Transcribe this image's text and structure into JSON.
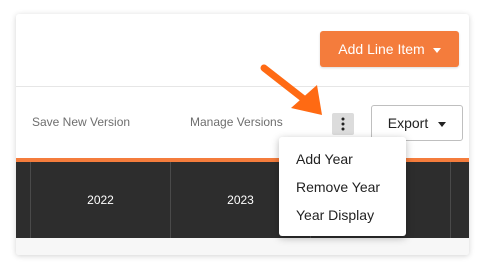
{
  "colors": {
    "accent": "#f47c3c",
    "table_header_bg": "#2d2d2d",
    "kebab_bg": "#dcdcdc"
  },
  "header": {
    "add_line_item_label": "Add Line Item"
  },
  "toolbar": {
    "save_new_version_label": "Save New Version",
    "manage_versions_label": "Manage Versions",
    "more_actions_icon": "vertical-ellipsis-icon",
    "export_label": "Export"
  },
  "table": {
    "columns": [
      "2022",
      "2023",
      "",
      ""
    ]
  },
  "menu": {
    "items": [
      {
        "label": "Add Year"
      },
      {
        "label": "Remove Year"
      },
      {
        "label": "Year Display"
      }
    ]
  },
  "annotation": {
    "arrow_icon": "callout-arrow-icon"
  }
}
